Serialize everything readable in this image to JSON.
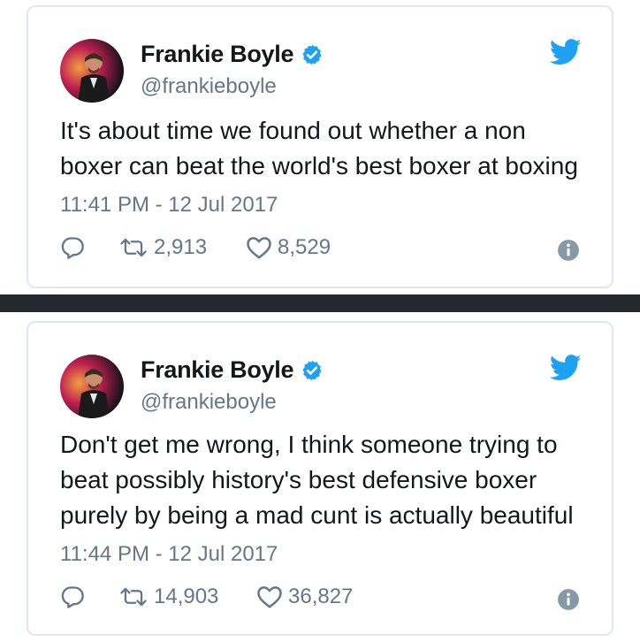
{
  "tweets": [
    {
      "display_name": "Frankie Boyle",
      "handle": "@frankieboyle",
      "text": "It's about time we found out whether a non boxer can beat the world's best boxer at boxing",
      "timestamp": "11:41 PM - 12 Jul 2017",
      "retweets": "2,913",
      "likes": "8,529"
    },
    {
      "display_name": "Frankie Boyle",
      "handle": "@frankieboyle",
      "text": "Don't get me wrong, I think someone trying to beat possibly history's best defensive boxer purely by being a mad cunt is actually beautiful",
      "timestamp": "11:44 PM - 12 Jul 2017",
      "retweets": "14,903",
      "likes": "36,827"
    }
  ],
  "icons": {
    "reply": "reply-icon",
    "retweet": "retweet-icon",
    "like": "heart-icon",
    "info": "info-icon",
    "verified": "verified-badge-icon",
    "brand": "twitter-bird-icon"
  },
  "colors": {
    "twitter_blue": "#1da1f2",
    "text_primary": "#14171a",
    "text_secondary": "#657786",
    "divider": "#24292f"
  }
}
